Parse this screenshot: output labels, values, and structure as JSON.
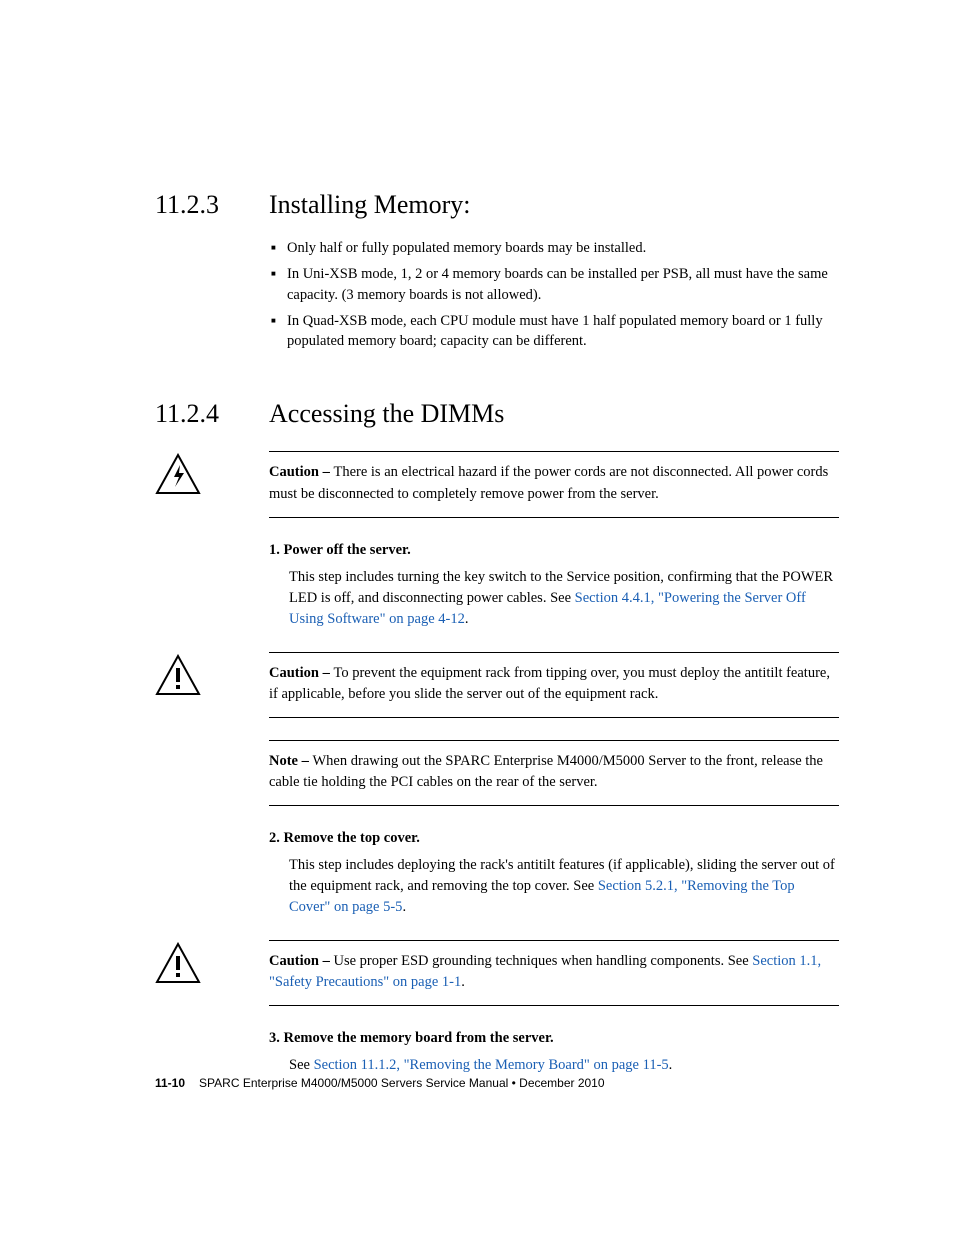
{
  "sec1": {
    "num": "11.2.3",
    "title": "Installing Memory:"
  },
  "bullets": {
    "b1": "Only half or fully populated memory boards may be installed.",
    "b2": "In Uni-XSB mode, 1, 2 or 4 memory boards can be installed per PSB, all must have the same capacity. (3 memory boards is not allowed).",
    "b3": "In Quad-XSB mode, each CPU module must have 1 half populated memory board or 1 fully populated memory board; capacity can be different."
  },
  "sec2": {
    "num": "11.2.4",
    "title": "Accessing the DIMMs"
  },
  "caution1": {
    "label": "Caution – ",
    "text": "There is an electrical hazard if the power cords are not disconnected. All power cords must be disconnected to completely remove power from the server."
  },
  "step1": {
    "head": "1.  Power off the server.",
    "body_a": "This step includes turning the key switch to the Service position, confirming that the POWER LED is off, and disconnecting power cables. See ",
    "link": "Section 4.4.1, \"Powering the Server Off Using Software\" on page 4-12",
    "body_b": "."
  },
  "caution2": {
    "label": "Caution – ",
    "text": "To prevent the equipment rack from tipping over, you must deploy the antitilt feature, if applicable, before you slide the server out of the equipment rack."
  },
  "note1": {
    "label": "Note – ",
    "text": "When drawing out the SPARC Enterprise M4000/M5000 Server to the front, release the cable tie holding the PCI cables on the rear of the server."
  },
  "step2": {
    "head": "2.  Remove the top cover.",
    "body_a": "This step includes deploying the rack's antitilt features (if applicable), sliding the server out of the equipment rack, and removing the top cover. See ",
    "link": "Section 5.2.1, \"Removing the Top Cover\" on page 5-5",
    "body_b": "."
  },
  "caution3": {
    "label": "Caution – ",
    "text_a": "Use proper ESD grounding techniques when handling components. See ",
    "link": "Section 1.1, \"Safety Precautions\" on page 1-1",
    "text_b": "."
  },
  "step3": {
    "head": "3.  Remove the memory board from the server.",
    "body_a": "See ",
    "link": "Section 11.1.2, \"Removing the Memory Board\" on page 11-5",
    "body_b": "."
  },
  "footer": {
    "page": "11-10",
    "text": "SPARC Enterprise M4000/M5000 Servers Service Manual  •  December 2010"
  }
}
